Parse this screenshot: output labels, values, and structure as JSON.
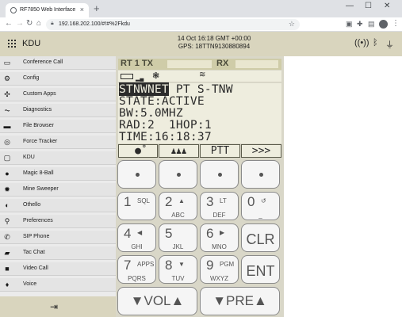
{
  "browser": {
    "tab_title": "RF7850 Web Interface",
    "tab_close": "×",
    "new_tab": "+",
    "url": "192.168.202.100/#!#%2Fkdu",
    "win_min": "—",
    "win_max": "☐",
    "win_close": "✕"
  },
  "header": {
    "title": "KDU",
    "datetime": "14 Oct 16:18 GMT +00:00",
    "gps": "GPS: 18TTN9130880894"
  },
  "sidebar": {
    "items": [
      {
        "label": "Conference Call",
        "icon": "chat-icon"
      },
      {
        "label": "Config",
        "icon": "gear-icon"
      },
      {
        "label": "Custom Apps",
        "icon": "puzzle-icon"
      },
      {
        "label": "Diagnostics",
        "icon": "pulse-icon"
      },
      {
        "label": "File Browser",
        "icon": "folder-icon"
      },
      {
        "label": "Force Tracker",
        "icon": "target-icon"
      },
      {
        "label": "KDU",
        "icon": "radio-icon"
      },
      {
        "label": "Magic 8-Ball",
        "icon": "ball-icon"
      },
      {
        "label": "Mine Sweeper",
        "icon": "mine-icon"
      },
      {
        "label": "Othello",
        "icon": "disc-icon"
      },
      {
        "label": "Preferences",
        "icon": "location-icon"
      },
      {
        "label": "SIP Phone",
        "icon": "phone-icon"
      },
      {
        "label": "Tac Chat",
        "icon": "message-icon"
      },
      {
        "label": "Video Call",
        "icon": "video-icon"
      },
      {
        "label": "Voice",
        "icon": "mic-icon"
      }
    ],
    "logout_icon": "logout-icon"
  },
  "radio": {
    "rt_label": "RT 1 TX",
    "rx_label": "RX",
    "lcd_lines": [
      {
        "highlight": "STNWNET",
        "rest": " PT S-TNW"
      },
      {
        "text": "STATE:ACTIVE"
      },
      {
        "text": "BW:5.0MHZ"
      },
      {
        "text": "RAD:2  1HOP:1"
      },
      {
        "text": "TIME:16:18:37"
      }
    ],
    "softkeys": {
      "k3": "PTT",
      "k4": ">>>"
    },
    "keypad": {
      "k1": {
        "num": "1",
        "sup": "SQL",
        "sub": ""
      },
      "k2": {
        "num": "2",
        "sup": "▲",
        "sub": "ABC"
      },
      "k3": {
        "num": "3",
        "sup": "LT",
        "sub": "DEF"
      },
      "k0": {
        "num": "0",
        "sup": "↺",
        "sub": "_"
      },
      "k4": {
        "num": "4",
        "sup": "◀",
        "sub": "GHI"
      },
      "k5": {
        "num": "5",
        "sup": "",
        "sub": "JKL"
      },
      "k6": {
        "num": "6",
        "sup": "▶",
        "sub": "MNO"
      },
      "clr": "CLR",
      "k7": {
        "num": "7",
        "sup": "APPS",
        "sub": "PQRS"
      },
      "k8": {
        "num": "8",
        "sup": "▼",
        "sub": "TUV"
      },
      "k9": {
        "num": "9",
        "sup": "PGM",
        "sub": "WXYZ"
      },
      "ent": "ENT",
      "vol": "▼VOL▲",
      "pre": "▼PRE▲"
    }
  },
  "colors": {
    "header_bg": "#d9d5be",
    "lcd_bg": "#eeedde",
    "sidebar_bg": "#e4e4e4"
  }
}
